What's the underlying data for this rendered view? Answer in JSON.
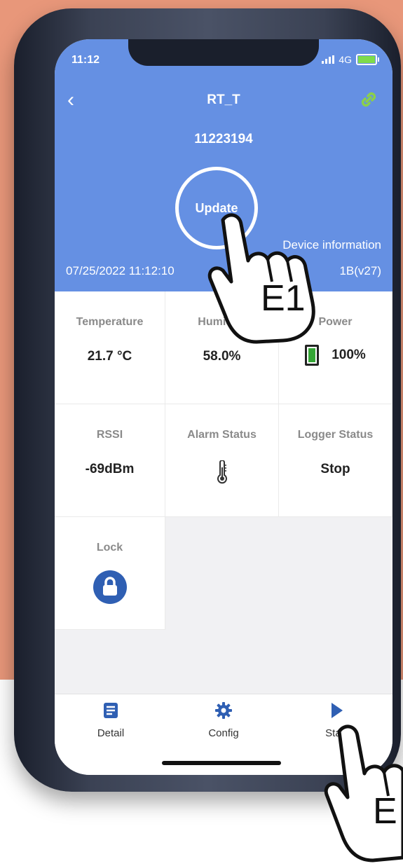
{
  "status_bar": {
    "time": "11:12",
    "network": "4G"
  },
  "header": {
    "title": "RT_T",
    "serial": "11223194",
    "update_label": "Update",
    "datetime": "07/25/2022 11:12:10",
    "device_info_label": "Device information",
    "firmware": "1B(v27)"
  },
  "cells": {
    "temperature": {
      "label": "Temperature",
      "value": "21.7 °C"
    },
    "humidity": {
      "label": "Humidity",
      "value": "58.0%"
    },
    "power": {
      "label": "Power",
      "value": "100%",
      "level": 1.0
    },
    "rssi": {
      "label": "RSSI",
      "value": "-69dBm"
    },
    "alarm": {
      "label": "Alarm Status",
      "icon": "thermometer-icon"
    },
    "logger": {
      "label": "Logger Status",
      "value": "Stop"
    },
    "lock": {
      "label": "Lock",
      "icon": "lock-icon"
    }
  },
  "tabs": [
    {
      "label": "Detail",
      "icon": "document-icon"
    },
    {
      "label": "Config",
      "icon": "gear-icon"
    },
    {
      "label": "Start",
      "icon": "play-icon"
    }
  ],
  "annotations": {
    "hand1": "E1",
    "hand2": "E"
  },
  "colors": {
    "header": "#6590e3",
    "accent": "#2f5fb3",
    "link": "#8bd04a",
    "power": "#35a636",
    "page_bg": "#e8977a"
  }
}
